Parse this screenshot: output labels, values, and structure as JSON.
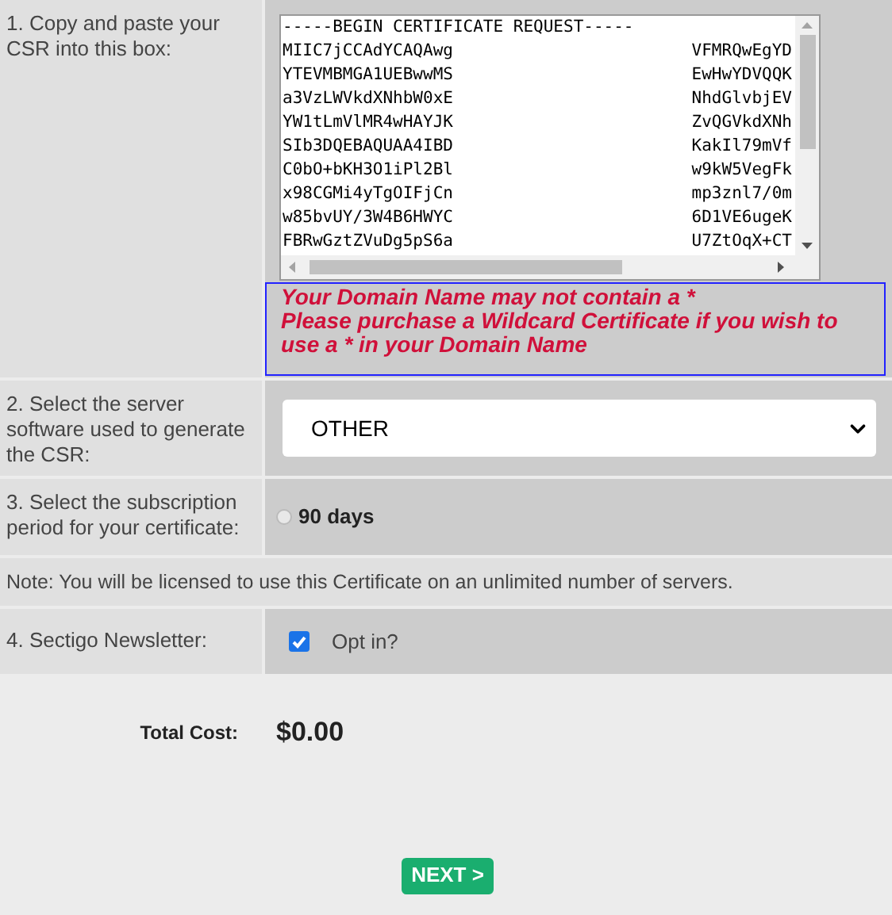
{
  "csr_row": {
    "label": "1. Copy and paste your CSR into this box:",
    "csr_lines": [
      {
        "left": "-----BEGIN CERTIFICATE REQUEST-----"
      },
      {
        "left": "MIIC7jCCAdYCAQAwg",
        "right": "VFMRQwEgYD"
      },
      {
        "left": "YTEVMBMGA1UEBwwMS",
        "right": "EwHwYDVQQK"
      },
      {
        "left": "a3VzLWVkdXNhbW0xE",
        "right": "NhdGlvbjEV"
      },
      {
        "left": "YW1tLmVlMR4wHAYJK",
        "right": "ZvQGVkdXNh"
      },
      {
        "left": "SIb3DQEBAQUAA4IBD",
        "right": "KakIl79mVf"
      },
      {
        "left": "C0bO+bKH3O1iPl2Bl",
        "right": "w9kW5VegFk"
      },
      {
        "left": "x98CGMi4yTgOIFjCn",
        "right": "mp3znl7/0m"
      },
      {
        "left": "w85bvUY/3W4B6HWYC",
        "right": "6D1VE6ugeK"
      },
      {
        "left": "FBRwGztZVuDg5pS6a",
        "right": "U7ZtOqX+CT"
      }
    ],
    "error_lines": [
      "Your Domain Name may not contain a *",
      "Please purchase a Wildcard Certificate if you wish to use a * in your Domain Name"
    ]
  },
  "server_row": {
    "label": "2. Select the server software used to generate the CSR:",
    "value": "OTHER"
  },
  "period_row": {
    "label": "3. Select the subscription period for your certificate:",
    "options": [
      {
        "label": "90 days",
        "selected": false
      }
    ]
  },
  "note": "Note: You will be licensed to use this Certificate on an unlimited number of servers.",
  "newsletter_row": {
    "label": "4. Sectigo Newsletter:",
    "option": "Opt in?",
    "checked": true
  },
  "total": {
    "label": "Total Cost:",
    "value": "$0.00"
  },
  "next_button": "NEXT >"
}
